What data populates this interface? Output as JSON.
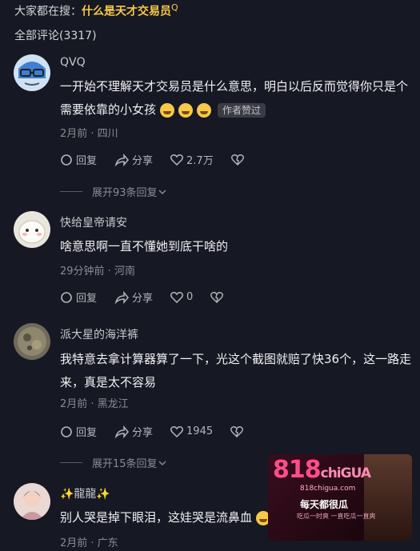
{
  "search": {
    "prefix": "大家都在搜：",
    "term": "什么是天才交易员"
  },
  "total": "全部评论(3317)",
  "comments": [
    {
      "user": "QVQ",
      "text": "一开始不理解天才交易员是什么意思，明白以后反而觉得你只是个需要依靠的小女孩",
      "badge": "作者赞过",
      "meta": "2月前 · 四川",
      "reply": "回复",
      "share": "分享",
      "likes": "2.7万",
      "expand": "展开93条回复"
    },
    {
      "user": "快给皇帝请安",
      "text": "啥意思啊一直不懂她到底干啥的",
      "meta": "29分钟前 · 河南",
      "reply": "回复",
      "share": "分享",
      "likes": "0"
    },
    {
      "user": "派大星的海洋裤",
      "text": "我特意去拿计算器算了一下，光这个截图就赔了快36个，这一路走来，真是太不容易",
      "meta": "2月前 · 黑龙江",
      "reply": "回复",
      "share": "分享",
      "likes": "1945",
      "expand": "展开15条回复"
    },
    {
      "user": "✨龍龍✨",
      "text": "别人哭是掉下眼泪，这娃哭是流鼻血",
      "meta": "2月前 · 广东"
    }
  ],
  "ad": {
    "logo": "818",
    "logo_sub": "chiGUA",
    "url": "818chigua.com",
    "slogan": "每天都很瓜",
    "sub": "吃瓜一时爽 一直吃瓜一直爽"
  }
}
